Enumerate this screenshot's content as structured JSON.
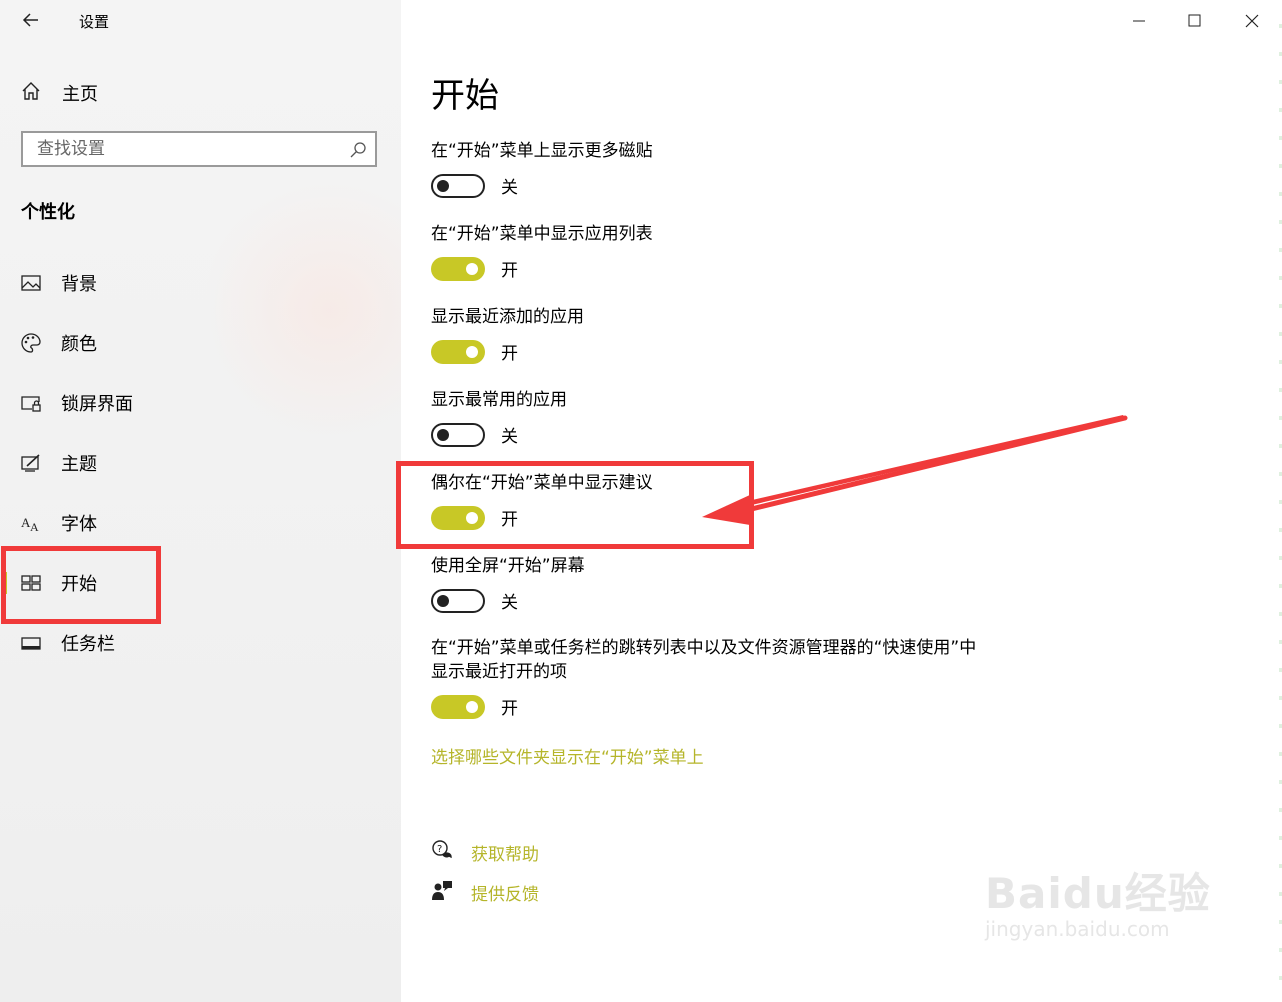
{
  "window": {
    "title": "设置"
  },
  "sidebar": {
    "home_label": "主页",
    "search_placeholder": "查找设置",
    "section_title": "个性化",
    "items": [
      {
        "label": "背景",
        "icon": "picture-icon"
      },
      {
        "label": "颜色",
        "icon": "palette-icon"
      },
      {
        "label": "锁屏界面",
        "icon": "lock-screen-icon"
      },
      {
        "label": "主题",
        "icon": "theme-icon"
      },
      {
        "label": "字体",
        "icon": "font-icon"
      },
      {
        "label": "开始",
        "icon": "start-icon",
        "active": true
      },
      {
        "label": "任务栏",
        "icon": "taskbar-icon"
      }
    ]
  },
  "main": {
    "title": "开始",
    "settings": [
      {
        "label": "在“开始”菜单上显示更多磁贴",
        "state": "关",
        "on": false
      },
      {
        "label": "在“开始”菜单中显示应用列表",
        "state": "开",
        "on": true
      },
      {
        "label": "显示最近添加的应用",
        "state": "开",
        "on": true
      },
      {
        "label": "显示最常用的应用",
        "state": "关",
        "on": false
      },
      {
        "label": "偶尔在“开始”菜单中显示建议",
        "state": "开",
        "on": true
      },
      {
        "label": "使用全屏“开始”屏幕",
        "state": "关",
        "on": false
      },
      {
        "label_line1": "在“开始”菜单或任务栏的跳转列表中以及文件资源管理器的“快速使用”中",
        "label_line2": "显示最近打开的项",
        "state": "开",
        "on": true
      }
    ],
    "folders_link": "选择哪些文件夹显示在“开始”菜单上",
    "help_label": "获取帮助",
    "feedback_label": "提供反馈"
  },
  "watermark": {
    "line1": "Baidu经验",
    "line2": "jingyan.baidu.com"
  },
  "colors": {
    "accent": "#c8c826",
    "link": "#b5b52a",
    "annotation": "#f03a3a"
  }
}
